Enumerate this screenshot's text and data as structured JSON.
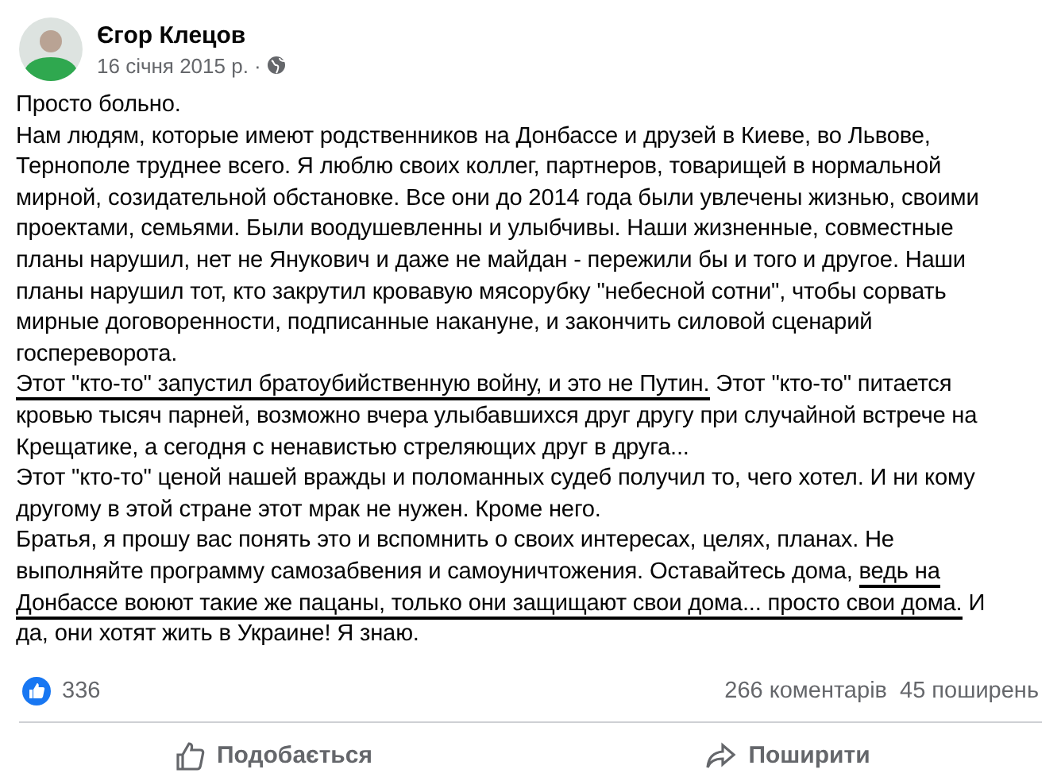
{
  "post": {
    "author": "Єгор Клецов",
    "date": "16 січня 2015 р. ·",
    "lines": [
      {
        "segments": [
          {
            "text": "Просто больно.",
            "underlined": false
          }
        ]
      },
      {
        "segments": [
          {
            "text": "Нам людям, которые имеют родственников на Донбассе и друзей в Киеве, во Львове,",
            "underlined": false
          }
        ]
      },
      {
        "segments": [
          {
            "text": "Тернополе труднее всего. Я люблю своих коллег, партнеров, товарищей в нормальной",
            "underlined": false
          }
        ]
      },
      {
        "segments": [
          {
            "text": "мирной, созидательной обстановке. Все они до 2014 года были увлечены жизнью, своими",
            "underlined": false
          }
        ]
      },
      {
        "segments": [
          {
            "text": "проектами, семьями. Были воодушевленны и улыбчивы. Наши жизненные, совместные",
            "underlined": false
          }
        ]
      },
      {
        "segments": [
          {
            "text": "планы нарушил, нет не Янукович и даже не майдан - пережили бы и того и другое. Наши",
            "underlined": false
          }
        ]
      },
      {
        "segments": [
          {
            "text": "планы нарушил тот, кто закрутил кровавую мясорубку \"небесной сотни\", чтобы сорвать",
            "underlined": false
          }
        ]
      },
      {
        "segments": [
          {
            "text": "мирные договоренности, подписанные накануне, и закончить силовой сценарий",
            "underlined": false
          }
        ]
      },
      {
        "segments": [
          {
            "text": "госпереворота.",
            "underlined": false
          }
        ]
      },
      {
        "segments": [
          {
            "text": "Этот \"кто-то\" запустил братоубийственную войну, и это не Путин.",
            "underlined": true
          },
          {
            "text": " Этот \"кто-то\" питается",
            "underlined": false
          }
        ]
      },
      {
        "segments": [
          {
            "text": "кровью тысяч парней, возможно вчера улыбавшихся друг другу при случайной встрече на",
            "underlined": false
          }
        ]
      },
      {
        "segments": [
          {
            "text": "Крещатике, а сегодня с ненавистью стреляющих друг в друга...",
            "underlined": false
          }
        ]
      },
      {
        "segments": [
          {
            "text": "Этот \"кто-то\" ценой нашей вражды и поломанных судеб получил то, чего хотел. И ни кому",
            "underlined": false
          }
        ]
      },
      {
        "segments": [
          {
            "text": "другому в этой стране этот мрак не нужен. Кроме него.",
            "underlined": false
          }
        ]
      },
      {
        "segments": [
          {
            "text": "Братья, я прошу вас понять это и вспомнить о своих интересах, целях, планах. Не",
            "underlined": false
          }
        ]
      },
      {
        "segments": [
          {
            "text": "выполняйте программу самозабвения и самоуничтожения. Оставайтесь дома, ",
            "underlined": false
          },
          {
            "text": "ведь на",
            "underlined": true
          }
        ]
      },
      {
        "segments": [
          {
            "text": "Донбассе воюют такие же пацаны, только они защищают свои дома... просто свои дома.",
            "underlined": true
          },
          {
            "text": " И",
            "underlined": false
          }
        ]
      },
      {
        "segments": [
          {
            "text": "да, они хотят жить в Украине! Я знаю.",
            "underlined": false
          }
        ]
      }
    ],
    "reactions": "336",
    "comments": "266 коментарів",
    "shares": "45 поширень",
    "actions": [
      {
        "kind": "like",
        "label": "Подобається"
      },
      {
        "kind": "share",
        "label": "Поширити"
      }
    ]
  }
}
